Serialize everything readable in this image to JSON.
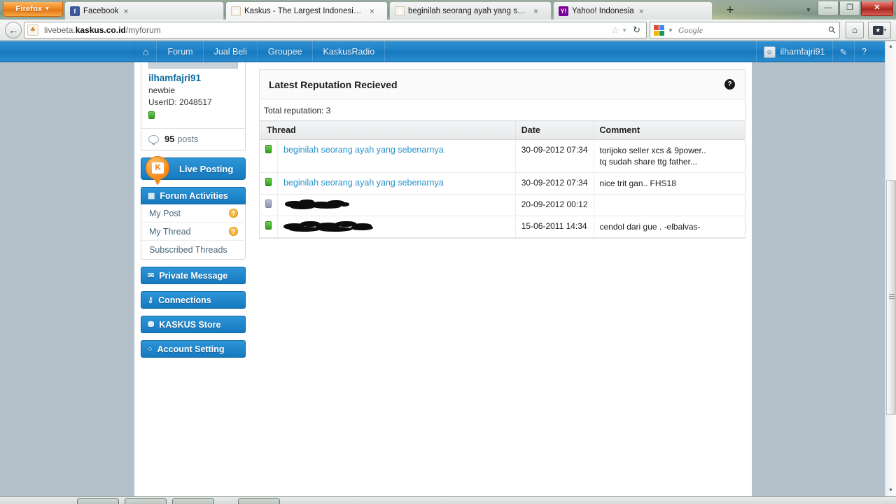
{
  "browser": {
    "app_button": "Firefox",
    "app_button_caret": "▼",
    "tabs": [
      {
        "title": "Facebook",
        "favicon": "facebook-icon",
        "favicon_glyph": "f",
        "close": "×",
        "active": false
      },
      {
        "title": "Kaskus - The Largest Indonesian Com...",
        "favicon": "kaskus-icon",
        "favicon_glyph": "☘",
        "close": "×",
        "active": true
      },
      {
        "title": "beginilah seorang ayah yang sebenar...",
        "favicon": "kaskus-icon",
        "favicon_glyph": "☘",
        "close": "×",
        "active": false
      },
      {
        "title": "Yahoo! Indonesia",
        "favicon": "yahoo-icon",
        "favicon_glyph": "Y!",
        "close": "×",
        "active": false
      }
    ],
    "new_tab": "+",
    "list_all_tabs": "▼",
    "window_controls": {
      "minimize": "—",
      "maximize": "❐",
      "close": "✕"
    },
    "back_button": "←",
    "url": {
      "prefix": "livebeta.",
      "host": "kaskus.co.id",
      "path": "/myforum",
      "site_icon_glyph": "☘"
    },
    "star": "☆",
    "star_caret": "▼",
    "reload": "↻",
    "search": {
      "engine": "Google",
      "placeholder": "Google",
      "value": "",
      "caret": "▼",
      "magnifier": "⚲"
    },
    "home_button": "⌂",
    "bookmarks_button": {
      "glyph": "★",
      "caret": "▾"
    }
  },
  "topbar": {
    "home_icon": "⌂",
    "nav": [
      "Forum",
      "Jual Beli",
      "Groupee",
      "KaskusRadio"
    ],
    "username": "ilhamfajri91",
    "avatar_glyph": "☺",
    "edit_icon": "✎",
    "help_icon": "?"
  },
  "sidebar": {
    "profile": {
      "username": "ilhamfajri91",
      "rank": "newbie",
      "userid_label": "UserID: 2048517",
      "posts_count": "95",
      "posts_word": "posts"
    },
    "live_posting": {
      "label": "Live Posting",
      "badge": "K"
    },
    "forum_activities": {
      "title": "Forum Activities",
      "icon": "grid-icon",
      "icon_glyph": "▦",
      "rows": [
        {
          "label": "My Post",
          "badge": "?"
        },
        {
          "label": "My Thread",
          "badge": "?"
        },
        {
          "label": "Subscribed Threads",
          "badge": ""
        }
      ]
    },
    "buttons": [
      {
        "label": "Private Message",
        "icon": "envelope-icon",
        "icon_glyph": "✉"
      },
      {
        "label": "Connections",
        "icon": "connections-icon",
        "icon_glyph": "⚷"
      },
      {
        "label": "KASKUS Store",
        "icon": "cart-icon",
        "icon_glyph": "⛃"
      },
      {
        "label": "Account Setting",
        "icon": "gear-icon",
        "icon_glyph": "○"
      }
    ]
  },
  "main": {
    "title": "Latest Reputation Recieved",
    "help_icon": "?",
    "total_reputation": "Total reputation: 3",
    "columns": {
      "thread": "Thread",
      "date": "Date",
      "comment": "Comment"
    },
    "rows": [
      {
        "rep": "green",
        "thread": "beginilah seorang ayah yang sebenarnya",
        "redacted": false,
        "date": "30-09-2012 07:34",
        "comment_lines": [
          "torijoko seller xcs & 9power..",
          "tq sudah share ttg father..."
        ]
      },
      {
        "rep": "green",
        "thread": "beginilah seorang ayah yang sebenarnya",
        "redacted": false,
        "date": "30-09-2012 07:34",
        "comment_lines": [
          "nice trit gan.. FHS18"
        ]
      },
      {
        "rep": "grey",
        "thread": "",
        "redacted": true,
        "date": "20-09-2012 00:12",
        "comment_lines": []
      },
      {
        "rep": "green",
        "thread": "",
        "redacted": true,
        "date": "15-06-2011 14:34",
        "comment_lines": [
          "cendol dari gue . -elbalvas-"
        ]
      }
    ]
  },
  "scrollbar": {
    "up_arrow": "▲",
    "down_arrow": "▼"
  },
  "colors": {
    "kaskus_blue": "#1579bf",
    "link_blue": "#2b93c8",
    "rep_green": "#2f9b1e",
    "rep_grey": "#8f90ab",
    "accent_orange": "#f58a1f",
    "page_bg": "#b4c1cb"
  }
}
